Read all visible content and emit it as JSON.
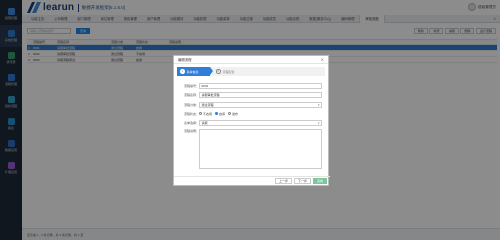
{
  "sidebar": {
    "items": [
      {
        "label": "权限管理",
        "icon": "grid-icon",
        "color": "#3f8fe0"
      },
      {
        "label": "系统管理",
        "icon": "monitor-icon",
        "color": "#2f7ed8"
      },
      {
        "label": "通讯录",
        "icon": "contacts-icon",
        "color": "#3a9f6a"
      },
      {
        "label": "流程管理",
        "icon": "flow-icon",
        "color": "#2f7ed8"
      },
      {
        "label": "我的流程",
        "icon": "share-icon",
        "color": "#33a3c9"
      },
      {
        "label": "报表",
        "icon": "chart-icon",
        "color": "#2a8fd2"
      },
      {
        "label": "数据应用",
        "icon": "database-icon",
        "color": "#2d6fc2"
      },
      {
        "label": "扩展应用",
        "icon": "gear-icon",
        "color": "#9a5fd0"
      }
    ]
  },
  "header": {
    "brand": "learun",
    "subtitle": "敏捷开发框架[6.1.6.0]",
    "user": "超级管理员"
  },
  "nav": {
    "tabs": [
      "功能主页",
      "公司管理",
      "部门管理",
      "岗位管理",
      "角色管理",
      "用户管理",
      "功能模块",
      "功能权限",
      "功能菜单",
      "功能过程",
      "功能成员",
      "功能边框",
      "数据(服务中心)",
      "编码管理",
      "功能审批",
      "审批导航",
      "消息管理",
      "应用设置管理",
      "审批节点"
    ],
    "active_tab": "审批流程",
    "close_label": "✕"
  },
  "toolbar": {
    "search_placeholder": "请输入查询关键字",
    "query_label": "查询",
    "actions": [
      "刷新",
      "新增",
      "编辑",
      "删除",
      "设计流程"
    ]
  },
  "grid": {
    "headers": [
      "",
      "流程编号",
      "流程名称",
      "流程分类",
      "流程状态",
      "流程说明"
    ],
    "rows": [
      {
        "idx": "1",
        "code": "0001",
        "name": "请假审批流程",
        "category": "通过流程",
        "status": "启用",
        "note": ""
      },
      {
        "idx": "2",
        "code": "0002",
        "name": "请假审批流程",
        "category": "通过流程",
        "status": "不启用",
        "note": ""
      },
      {
        "idx": "3",
        "code": "0003",
        "name": "请假流程测试",
        "category": "通过流程",
        "status": "启用",
        "note": ""
      }
    ]
  },
  "footer": {
    "pager": "显示第 1 - 3 条记录，共 3 条记录，共 1 页"
  },
  "modal": {
    "title": "编辑流程",
    "close_label": "✕",
    "steps": [
      {
        "num": "1",
        "label": "基本信息"
      },
      {
        "num": "2",
        "label": "流程配置"
      }
    ],
    "fields": {
      "code_label": "流程编号：",
      "code_value": "0001",
      "name_label": "流程名称：",
      "name_value": "请假审批流程",
      "category_label": "流程分类：",
      "category_value": "通过流程",
      "status_label": "流程状态：",
      "status_options": [
        "不启用",
        "启用",
        "发布"
      ],
      "status_selected": 1,
      "form_label": "表单选择：",
      "form_value": "请假",
      "note_label": "流程说明："
    },
    "buttons": {
      "prev": "上一步",
      "next": "下一步",
      "finish": "完成"
    }
  },
  "colors": {
    "sidebar_bg": "#1f2a3a",
    "accent": "#2f7ed8",
    "finish_button": "#7cc79a"
  }
}
